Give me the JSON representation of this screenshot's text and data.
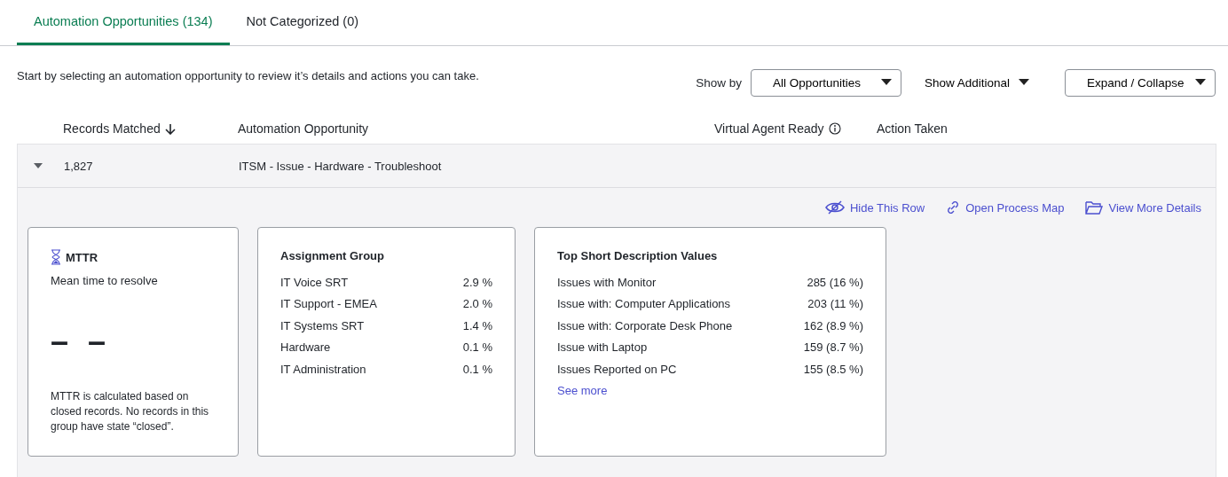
{
  "tabs": [
    {
      "label": "Automation Opportunities (134)",
      "selected": true
    },
    {
      "label": "Not Categorized (0)",
      "selected": false
    }
  ],
  "intro": "Start by selecting an automation opportunity to review it’s details and actions you can take.",
  "show_by": {
    "label": "Show by",
    "value": "All Opportunities"
  },
  "show_additional": "Show Additional",
  "expand_collapse": "Expand / Collapse",
  "columns": [
    "Records Matched",
    "Automation Opportunity",
    "Virtual Agent Ready",
    "Action Taken"
  ],
  "row": {
    "expanded": true,
    "records": "1,827",
    "opportunity": "ITSM - Issue - Hardware - Troubleshoot",
    "actions": [
      "Hide This Row",
      "Open Process Map",
      "View More Details"
    ],
    "mttr": {
      "title": "MTTR",
      "subtitle": "Mean time to resolve",
      "value": "– –",
      "note": "MTTR is calculated based on closed records. No records in this group have state “closed”."
    },
    "assignment": {
      "title": "Assignment Group",
      "items": [
        {
          "name": "IT Voice SRT",
          "value": "2.9 %"
        },
        {
          "name": "IT Support - EMEA",
          "value": "2.0 %"
        },
        {
          "name": "IT Systems SRT",
          "value": "1.4 %"
        },
        {
          "name": "Hardware",
          "value": "0.1 %"
        },
        {
          "name": "IT Administration",
          "value": "0.1 %"
        }
      ]
    },
    "short_desc": {
      "title": "Top Short Description Values",
      "items": [
        {
          "name": "Issues with Monitor",
          "value": "285 (16 %)"
        },
        {
          "name": "Issue with: Computer Applications",
          "value": "203 (11 %)"
        },
        {
          "name": "Issue with: Corporate Desk Phone",
          "value": "162 (8.9 %)"
        },
        {
          "name": "Issue with Laptop",
          "value": "159 (8.7 %)"
        },
        {
          "name": "Issues Reported on PC",
          "value": "155 (8.5 %)"
        }
      ],
      "link": "See more"
    }
  }
}
